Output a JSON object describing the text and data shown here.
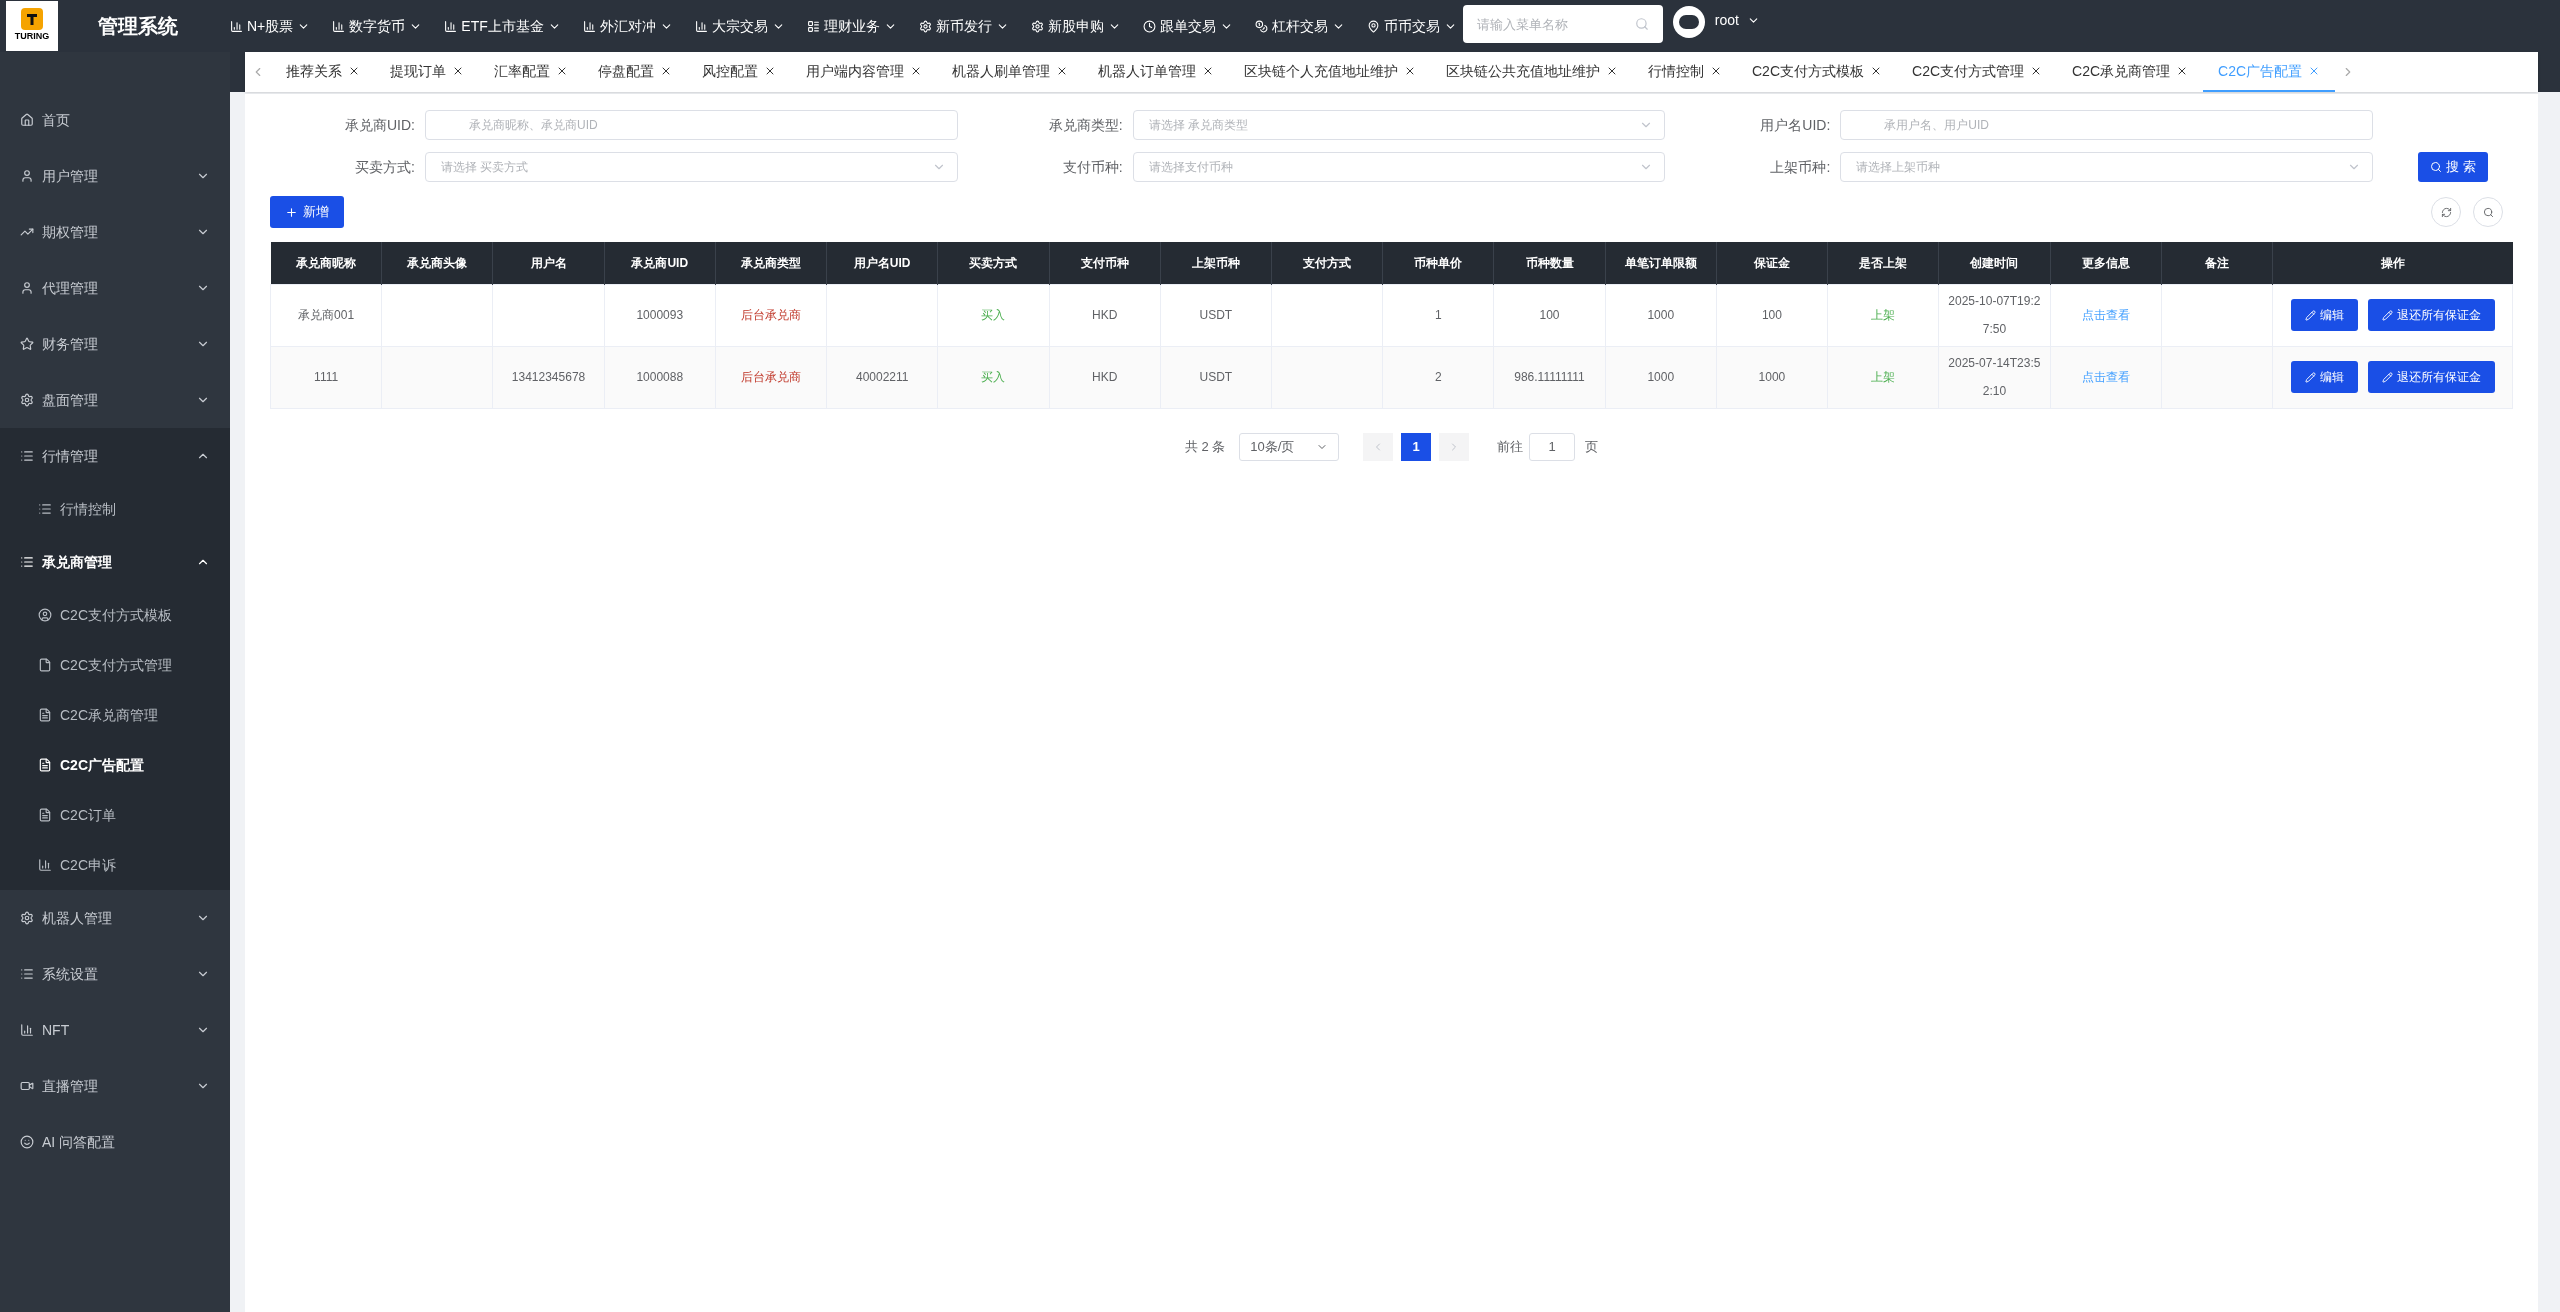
{
  "header": {
    "logo_text": "TURING",
    "title": "管理系统",
    "menu": [
      {
        "label": "N+股票"
      },
      {
        "label": "数字货币"
      },
      {
        "label": "ETF上市基金"
      },
      {
        "label": "外汇对冲"
      },
      {
        "label": "大宗交易"
      },
      {
        "label": "理财业务"
      },
      {
        "label": "新币发行"
      },
      {
        "label": "新股申购"
      },
      {
        "label": "跟单交易"
      },
      {
        "label": "杠杆交易"
      },
      {
        "label": "币币交易"
      }
    ],
    "search": {
      "placeholder": "请输入菜单名称"
    },
    "user": "root"
  },
  "sidebar": {
    "items": [
      {
        "label": "首页"
      },
      {
        "label": "用户管理",
        "expanded": false
      },
      {
        "label": "期权管理",
        "expanded": false
      },
      {
        "label": "代理管理",
        "expanded": false
      },
      {
        "label": "财务管理",
        "expanded": false
      },
      {
        "label": "盘面管理",
        "expanded": false
      },
      {
        "label": "行情管理",
        "expanded": true,
        "children": [
          {
            "label": "行情控制",
            "selected": false
          }
        ]
      },
      {
        "label": "承兑商管理",
        "expanded": true,
        "children": [
          {
            "label": "C2C支付方式模板",
            "selected": false
          },
          {
            "label": "C2C支付方式管理",
            "selected": false
          },
          {
            "label": "C2C承兑商管理",
            "selected": false
          },
          {
            "label": "C2C广告配置",
            "selected": true
          },
          {
            "label": "C2C订单",
            "selected": false
          },
          {
            "label": "C2C申诉",
            "selected": false
          }
        ]
      },
      {
        "label": "机器人管理",
        "expanded": false
      },
      {
        "label": "系统设置",
        "expanded": false
      },
      {
        "label": "NFT",
        "expanded": false
      },
      {
        "label": "直播管理",
        "expanded": false
      },
      {
        "label": "AI 问答配置"
      }
    ]
  },
  "tabs": [
    {
      "label": "推荐关系",
      "selected": false
    },
    {
      "label": "提现订单",
      "selected": false
    },
    {
      "label": "汇率配置",
      "selected": false
    },
    {
      "label": "停盘配置",
      "selected": false
    },
    {
      "label": "风控配置",
      "selected": false
    },
    {
      "label": "用户端内容管理",
      "selected": false
    },
    {
      "label": "机器人刷单管理",
      "selected": false
    },
    {
      "label": "机器人订单管理",
      "selected": false
    },
    {
      "label": "区块链个人充值地址维护",
      "selected": false
    },
    {
      "label": "区块链公共充值地址维护",
      "selected": false
    },
    {
      "label": "行情控制",
      "selected": false
    },
    {
      "label": "C2C支付方式模板",
      "selected": false
    },
    {
      "label": "C2C支付方式管理",
      "selected": false
    },
    {
      "label": "C2C承兑商管理",
      "selected": false
    },
    {
      "label": "C2C广告配置",
      "selected": true
    }
  ],
  "filters": [
    {
      "label": "承兑商UID:",
      "placeholder": "承兑商昵称、承兑商UID",
      "kind": "input"
    },
    {
      "label": "承兑商类型:",
      "placeholder": "请选择 承兑商类型",
      "kind": "select"
    },
    {
      "label": "用户名UID:",
      "placeholder": "承用户名、用户UID",
      "kind": "input"
    },
    {
      "label": "买卖方式:",
      "placeholder": "请选择 买卖方式",
      "kind": "select"
    },
    {
      "label": "支付币种:",
      "placeholder": "请选择支付币种",
      "kind": "select"
    },
    {
      "label": "上架币种:",
      "placeholder": "请选择上架币种",
      "kind": "select"
    }
  ],
  "search_button": "搜 索",
  "add_button": "新增",
  "table": {
    "columns": [
      {
        "label": "承兑商昵称"
      },
      {
        "label": "承兑商头像"
      },
      {
        "label": "用户名"
      },
      {
        "label": "承兑商UID"
      },
      {
        "label": "承兑商类型",
        "kind": "danger"
      },
      {
        "label": "用户名UID"
      },
      {
        "label": "买卖方式",
        "kind": "success"
      },
      {
        "label": "支付币种"
      },
      {
        "label": "上架币种"
      },
      {
        "label": "支付方式"
      },
      {
        "label": "币种单价"
      },
      {
        "label": "币种数量"
      },
      {
        "label": "单笔订单限额"
      },
      {
        "label": "保证金"
      },
      {
        "label": "是否上架",
        "kind": "success"
      },
      {
        "label": "创建时间"
      },
      {
        "label": "更多信息",
        "kind": "link"
      },
      {
        "label": "备注"
      }
    ],
    "actions_header": "操作",
    "rows": [
      {
        "cells": [
          "承兑商001",
          null,
          null,
          "1000093",
          "后台承兑商",
          null,
          "买入",
          "HKD",
          "USDT",
          null,
          "1",
          "100",
          "1000",
          "100",
          "上架",
          "2025-10-07T19:27:50",
          "点击查看",
          null
        ],
        "actions": [
          "编辑",
          "退还所有保证金"
        ]
      },
      {
        "cells": [
          "1111",
          null,
          "13412345678",
          "1000088",
          "后台承兑商",
          "40002211",
          "买入",
          "HKD",
          "USDT",
          null,
          "2",
          "986.11111111",
          "1000",
          "1000",
          "上架",
          "2025-07-14T23:52:10",
          "点击查看",
          null
        ],
        "actions": [
          "编辑",
          "退还所有保证金"
        ]
      }
    ]
  },
  "pagination": {
    "total": "共 2 条",
    "page_size": "10条/页",
    "pages": [
      {
        "label": "1",
        "selected": true
      }
    ],
    "goto_label": "前往",
    "goto_value": "1",
    "goto_unit": "页"
  }
}
